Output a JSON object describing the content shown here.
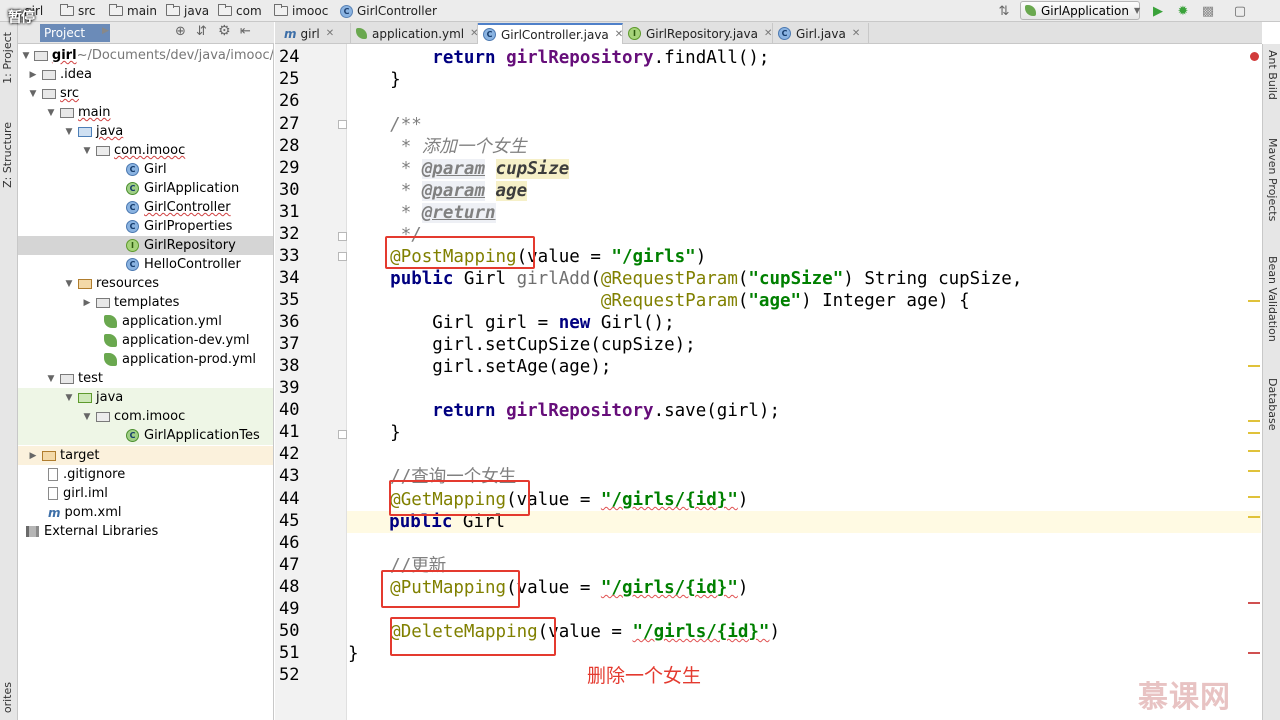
{
  "breadcrumb": {
    "items": [
      "girl",
      "src",
      "main",
      "java",
      "com",
      "imooc",
      "GirlController"
    ],
    "overlay_text": "暂停"
  },
  "toolbar": {
    "run_config": "GirlApplication"
  },
  "left_strip": {
    "tabs": [
      "1: Project",
      "Z: Structure",
      "orites"
    ]
  },
  "right_strip": {
    "tabs": [
      "Ant Build",
      "Maven Projects",
      "Bean Validation",
      "Database"
    ]
  },
  "project_panel": {
    "tab_label": "Project",
    "tree": [
      {
        "label": "girl",
        "suffix": " ~/Documents/dev/java/imooc/",
        "icon": "folder-icon",
        "depth": 0,
        "expanded": true
      },
      {
        "label": ".idea",
        "icon": "folder-icon",
        "depth": 1,
        "expanded": false
      },
      {
        "label": "src",
        "icon": "folder-icon",
        "depth": 1,
        "expanded": true
      },
      {
        "label": "main",
        "icon": "folder-icon",
        "depth": 2,
        "expanded": true
      },
      {
        "label": "java",
        "icon": "source-folder-icon",
        "depth": 3,
        "expanded": true
      },
      {
        "label": "com.imooc",
        "icon": "package-icon",
        "depth": 4,
        "expanded": true
      },
      {
        "label": "Girl",
        "icon": "class-icon",
        "depth": 5
      },
      {
        "label": "GirlApplication",
        "icon": "spring-class-icon",
        "depth": 5
      },
      {
        "label": "GirlController",
        "icon": "class-icon",
        "depth": 5
      },
      {
        "label": "GirlProperties",
        "icon": "class-icon",
        "depth": 5
      },
      {
        "label": "GirlRepository",
        "icon": "interface-icon",
        "depth": 5,
        "selected": true
      },
      {
        "label": "HelloController",
        "icon": "class-icon",
        "depth": 5
      },
      {
        "label": "resources",
        "icon": "resources-folder-icon",
        "depth": 3,
        "expanded": true
      },
      {
        "label": "templates",
        "icon": "folder-icon",
        "depth": 4,
        "expanded": false
      },
      {
        "label": "application.yml",
        "icon": "spring-leaf-icon",
        "depth": 4
      },
      {
        "label": "application-dev.yml",
        "icon": "spring-leaf-icon",
        "depth": 4
      },
      {
        "label": "application-prod.yml",
        "icon": "spring-leaf-icon",
        "depth": 4
      },
      {
        "label": "test",
        "icon": "folder-icon",
        "depth": 2,
        "expanded": true
      },
      {
        "label": "java",
        "icon": "test-source-folder-icon",
        "depth": 3,
        "expanded": true
      },
      {
        "label": "com.imooc",
        "icon": "package-icon",
        "depth": 4,
        "expanded": true
      },
      {
        "label": "GirlApplicationTes",
        "icon": "test-class-icon",
        "depth": 5
      },
      {
        "label": "target",
        "icon": "target-folder-icon",
        "depth": 0,
        "expanded": false
      },
      {
        "label": ".gitignore",
        "icon": "file-icon",
        "depth": 1
      },
      {
        "label": "girl.iml",
        "icon": "file-icon",
        "depth": 1
      },
      {
        "label": "pom.xml",
        "icon": "maven-icon",
        "depth": 1
      },
      {
        "label": "External Libraries",
        "icon": "library-icon",
        "depth": -1
      }
    ]
  },
  "editor": {
    "tabs": [
      {
        "label": "girl",
        "icon": "maven-icon"
      },
      {
        "label": "application.yml",
        "icon": "spring-leaf-icon"
      },
      {
        "label": "GirlController.java",
        "icon": "class-icon",
        "active": true
      },
      {
        "label": "GirlRepository.java",
        "icon": "interface-icon"
      },
      {
        "label": "Girl.java",
        "icon": "class-icon"
      }
    ],
    "line_numbers": [
      "24",
      "25",
      "26",
      "27",
      "28",
      "29",
      "30",
      "31",
      "32",
      "33",
      "34",
      "35",
      "36",
      "37",
      "38",
      "39",
      "40",
      "41",
      "42",
      "43",
      "44",
      "45",
      "46",
      "47",
      "48",
      "49",
      "50",
      "51",
      "52"
    ],
    "code": {
      "l24_kw": "return",
      "l24_fld": "girlRepository",
      "l24_rest": ".findAll();",
      "l25": "}",
      "l27": "/**",
      "l28": " * 添加一个女生",
      "l29_star": " * ",
      "l29_tag": "@param",
      "l29_p": "cupSize",
      "l30_star": " * ",
      "l30_tag": "@param",
      "l30_p": "age",
      "l31_star": " * ",
      "l31_tag": "@return",
      "l32": " */",
      "l33_ann": "@PostMapping",
      "l33_a": "(value = ",
      "l33_str": "\"/girls\"",
      "l33_b": ")",
      "l34_kw": "public",
      "l34_a": " Girl ",
      "l34_m": "girlAdd",
      "l34_b": "(",
      "l34_ann": "@RequestParam",
      "l34_c": "(",
      "l34_str": "\"cupSize\"",
      "l34_d": ") String cupSize,",
      "l35_ann": "@RequestParam",
      "l35_a": "(",
      "l35_str": "\"age\"",
      "l35_b": ") Integer age) {",
      "l36_a": "Girl girl = ",
      "l36_kw": "new",
      "l36_b": " Girl();",
      "l37": "girl.setCupSize(cupSize);",
      "l38": "girl.setAge(age);",
      "l40_kw": "return",
      "l40_fld": "girlRepository",
      "l40_rest": ".save(girl);",
      "l41": "}",
      "l43": "//查询一个女生",
      "l44_ann": "@GetMapping",
      "l44_a": "(value = ",
      "l44_str": "\"/girls/{id}\"",
      "l44_b": ")",
      "l45_kw": "public",
      "l45_a": " Girl",
      "l47": "//更新",
      "l48_ann": "@PutMapping",
      "l48_a": "(value = ",
      "l48_str": "\"/girls/{id}\"",
      "l48_b": ")",
      "l50_ann": "@DeleteMapping",
      "l50_a": "(value = ",
      "l50_str": "\"/girls/{id}\"",
      "l50_b": ")",
      "l51": "}"
    }
  },
  "annotation_caption": "删除一个女生",
  "watermark": "慕课网",
  "colors": {
    "highlight_box": "#e43a2f",
    "keyword": "#000080",
    "string": "#008000",
    "annotation": "#808000",
    "field": "#660e7a",
    "comment": "#808080"
  }
}
